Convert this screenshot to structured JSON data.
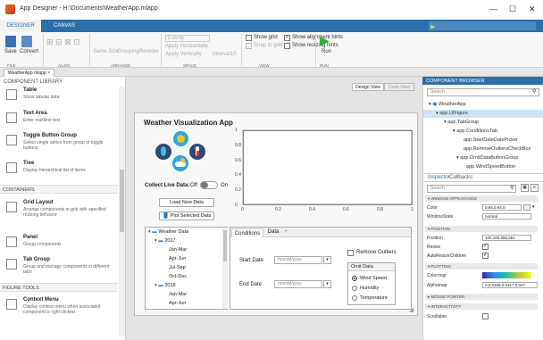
{
  "window": {
    "title": "App Designer - H:\\Documents\\WeatherApp.mlapp"
  },
  "tabs": {
    "designer": "DESIGNER",
    "canvas": "CANVAS"
  },
  "ribbon": {
    "save": "Save",
    "convert": "Convert",
    "sametsize": "Same Size",
    "grouping": "Grouping",
    "reorder": "Reorder",
    "evenly": "Evenly",
    "apply_h": "Apply Horizontally",
    "apply_v": "Apply Vertically",
    "interval": "Interval:",
    "interval_val": "10",
    "show_grid": "Show grid",
    "snap_grid": "Snap to grid",
    "show_align": "Show alignment hints",
    "show_resize": "Show resizing hints",
    "run": "Run",
    "sections": [
      "FILE",
      "ALIGN",
      "ARRANGE",
      "SPACE",
      "VIEW",
      "RUN"
    ]
  },
  "doc_tab": "WeatherApp.mlapp",
  "library": {
    "header": "COMPONENT LIBRARY",
    "items_top": [
      {
        "name": "Table",
        "desc": "Show tabular data"
      },
      {
        "name": "Text Area",
        "desc": "Enter multiline text"
      },
      {
        "name": "Toggle Button Group",
        "desc": "Select single option from group of toggle buttons"
      },
      {
        "name": "Tree",
        "desc": "Display hierarchical list of items"
      }
    ],
    "containers": "CONTAINERS",
    "items_cont": [
      {
        "name": "Grid Layout",
        "desc": "Arrange components in grid with specified resizing behavior"
      },
      {
        "name": "Panel",
        "desc": "Group components"
      },
      {
        "name": "Tab Group",
        "desc": "Group and manage components in different tabs"
      }
    ],
    "figure_tools": "FIGURE TOOLS",
    "items_fig": [
      {
        "name": "Context Menu",
        "desc": "Display context menu when associated component is right-clicked"
      }
    ]
  },
  "view": {
    "design": "Design View",
    "code": "Code View"
  },
  "app": {
    "title": "Weather Visualization App",
    "collect": "Collect Live Data:",
    "off": "Off",
    "on": "On",
    "load": "Load New Data",
    "plot": "Plot Selected Data",
    "tree": [
      "Weather Data",
      "2017",
      "Jan-Mar",
      "Apr-Jun",
      "Jul-Sep",
      "Oct-Dec",
      "2018",
      "Jan-Mar",
      "Apr-Jun"
    ],
    "tabs": [
      "Conditions",
      "Data",
      "+"
    ],
    "start": "Start Date",
    "end": "End Date",
    "date_ph": "mm/dd/yyyy",
    "remove": "Remove Outliers",
    "omit": "Omit Data",
    "radios": [
      "Wind Speed",
      "Humidity",
      "Temperature"
    ]
  },
  "chart_data": {
    "type": "line",
    "x_ticks": [
      "0",
      "0.2",
      "0.4",
      "0.6",
      "0.8",
      "1"
    ],
    "y_ticks": [
      "1",
      "0.8",
      "0.6",
      "0.4",
      "0.2",
      "0"
    ],
    "xlim": [
      0,
      1
    ],
    "ylim": [
      0,
      1
    ],
    "series": []
  },
  "browser": {
    "header": "COMPONENT BROWSER",
    "search_ph": "Search",
    "tree": [
      "WeatherApp",
      "app.UIFigure",
      "app.TabGroup",
      "app.ConditionsTab",
      "app.StartDateDatePicker",
      "app.RemoveOutliersCheckBox",
      "app.OmitDataButtonGroup",
      "app.WindSpeedButton"
    ],
    "inspector": "Inspector",
    "callbacks": "Callbacks",
    "sections": [
      "WINDOW APPEARANCE",
      "POSITION",
      "PLOTTING",
      "MOUSE POINTER",
      "INTERACTIVITY"
    ],
    "color_label": "Color",
    "color_val": "0.94,0.94,0",
    "windowstate_label": "WindowState",
    "windowstate_val": "normal",
    "position_label": "Position",
    "position_val": "100,100,656,562",
    "resize_label": "Resize",
    "autoresize_label": "AutoResizeChildren",
    "colormap_label": "Colormap",
    "alphamap_label": "Alphamap",
    "alphamap_val": "0,0.0159,0.0317,0.047",
    "scrollable_label": "Scrollable"
  },
  "colors": {
    "accent": "#2b6ea8",
    "selected": "#cfe3f5"
  }
}
